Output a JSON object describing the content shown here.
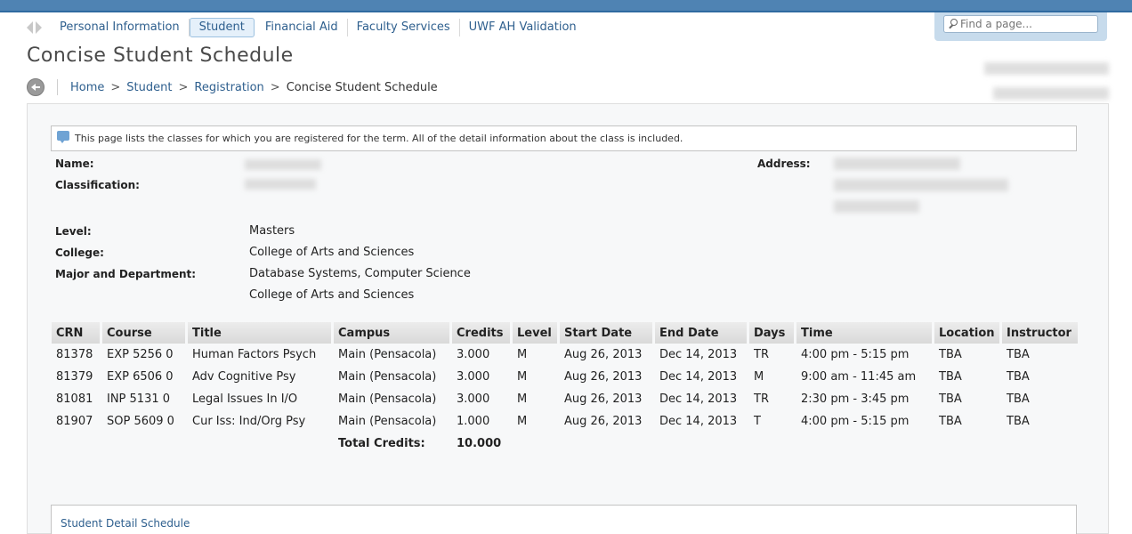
{
  "nav": {
    "items": [
      {
        "label": "Personal Information",
        "active": false
      },
      {
        "label": "Student",
        "active": true
      },
      {
        "label": "Financial Aid",
        "active": false
      },
      {
        "label": "Faculty Services",
        "active": false
      },
      {
        "label": "UWF AH Validation",
        "active": false
      }
    ]
  },
  "search": {
    "placeholder": "Find a page..."
  },
  "page": {
    "title": "Concise Student Schedule"
  },
  "breadcrumb": {
    "items": [
      "Home",
      "Student",
      "Registration"
    ],
    "separator": ">",
    "current": "Concise Student Schedule"
  },
  "info": {
    "text": "This page lists the classes for which you are registered for the term. All of the detail information about the class is included."
  },
  "student": {
    "name_label": "Name:",
    "classification_label": "Classification:",
    "address_label": "Address:",
    "level_label": "Level:",
    "level": "Masters",
    "college_label": "College:",
    "college": "College of Arts and Sciences",
    "major_label": "Major and Department:",
    "major": "Database Systems, Computer Science",
    "department": "College of Arts and Sciences"
  },
  "schedule": {
    "headers": [
      "CRN",
      "Course",
      "Title",
      "Campus",
      "Credits",
      "Level",
      "Start Date",
      "End Date",
      "Days",
      "Time",
      "Location",
      "Instructor"
    ],
    "rows": [
      [
        "81378",
        "EXP 5256 0",
        "Human Factors Psych",
        "Main (Pensacola)",
        "3.000",
        "M",
        "Aug 26, 2013",
        "Dec 14, 2013",
        "TR",
        "4:00 pm - 5:15 pm",
        "TBA",
        "TBA"
      ],
      [
        "81379",
        "EXP 6506 0",
        "Adv Cognitive Psy",
        "Main (Pensacola)",
        "3.000",
        "M",
        "Aug 26, 2013",
        "Dec 14, 2013",
        "M",
        "9:00 am - 11:45 am",
        "TBA",
        "TBA"
      ],
      [
        "81081",
        "INP 5131 0",
        "Legal Issues In I/O",
        "Main (Pensacola)",
        "3.000",
        "M",
        "Aug 26, 2013",
        "Dec 14, 2013",
        "TR",
        "2:30 pm - 3:45 pm",
        "TBA",
        "TBA"
      ],
      [
        "81907",
        "SOP 5609 0",
        "Cur Iss: Ind/Org Psy",
        "Main (Pensacola)",
        "1.000",
        "M",
        "Aug 26, 2013",
        "Dec 14, 2013",
        "T",
        "4:00 pm - 5:15 pm",
        "TBA",
        "TBA"
      ]
    ],
    "total_label": "Total Credits:",
    "total_value": "10.000"
  },
  "detail_link": "Student Detail Schedule",
  "colors": {
    "accent": "#2e5f8e",
    "topbar": "#4f83b3"
  }
}
